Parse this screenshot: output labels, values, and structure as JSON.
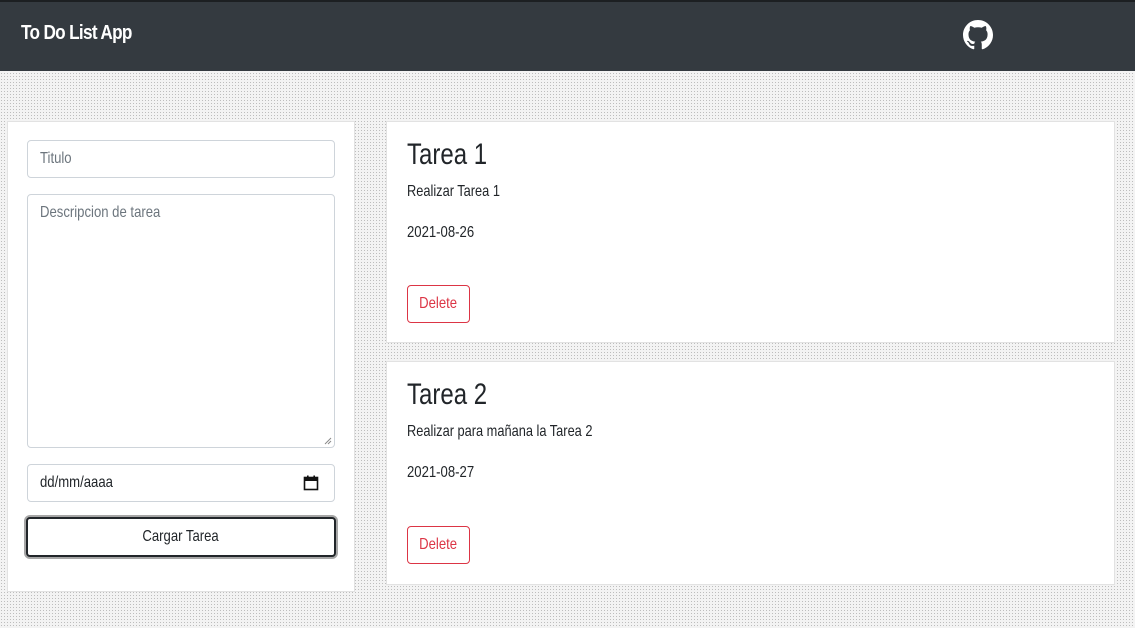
{
  "navbar": {
    "brand": "To Do List App",
    "github_icon": "github-icon",
    "background": "#343a40"
  },
  "form": {
    "title_placeholder": "Titulo",
    "description_placeholder": "Descripcion de tarea",
    "date_placeholder": "dd/mm/aaaa",
    "calendar_icon": "calendar-icon",
    "submit_label": "Cargar Tarea"
  },
  "tasks": [
    {
      "title": "Tarea 1",
      "description": "Realizar Tarea 1",
      "date": "2021-08-26",
      "delete_label": "Delete"
    },
    {
      "title": "Tarea 2",
      "description": "Realizar para mañana la Tarea 2",
      "date": "2021-08-27",
      "delete_label": "Delete"
    }
  ],
  "colors": {
    "danger": "#dc3545",
    "text": "#212529",
    "placeholder": "#6c757d"
  }
}
